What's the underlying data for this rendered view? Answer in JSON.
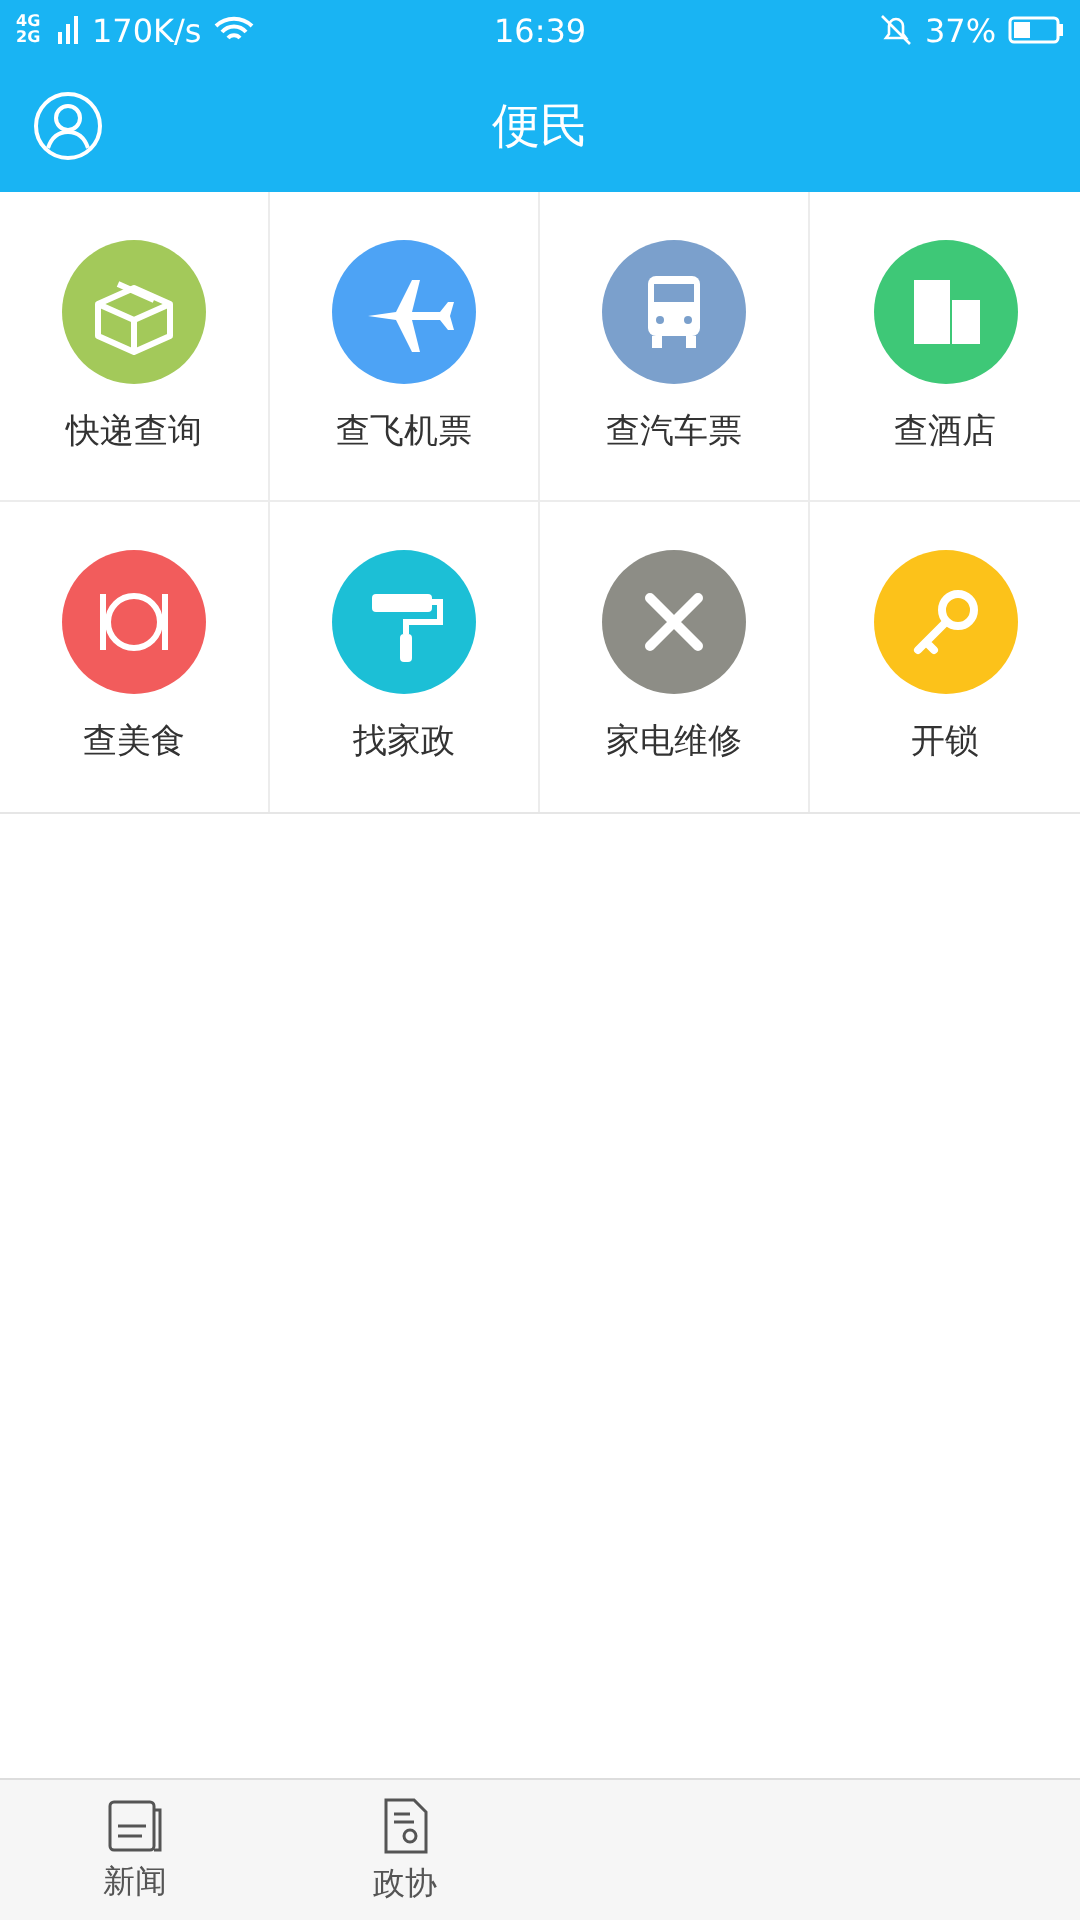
{
  "status_bar": {
    "network": "4G 2G",
    "speed": "170K/s",
    "time": "16:39",
    "battery": "37%"
  },
  "header": {
    "title": "便民"
  },
  "services": [
    {
      "label": "快递查询",
      "kind": "parcel",
      "color": "#a3c95a"
    },
    {
      "label": "查飞机票",
      "kind": "plane",
      "color": "#4da3f5"
    },
    {
      "label": "查汽车票",
      "kind": "bus",
      "color": "#7ba0cc"
    },
    {
      "label": "查酒店",
      "kind": "hotel",
      "color": "#3ec877"
    },
    {
      "label": "查美食",
      "kind": "food",
      "color": "#f25c5c"
    },
    {
      "label": "找家政",
      "kind": "roller",
      "color": "#1cbfd6"
    },
    {
      "label": "家电维修",
      "kind": "tools",
      "color": "#8d8d86"
    },
    {
      "label": "开锁",
      "kind": "key",
      "color": "#fcc21a"
    }
  ],
  "tab_bar": [
    {
      "label": "新闻",
      "kind": "news",
      "selected": false
    },
    {
      "label": "政协",
      "kind": "doc",
      "selected": false
    }
  ]
}
